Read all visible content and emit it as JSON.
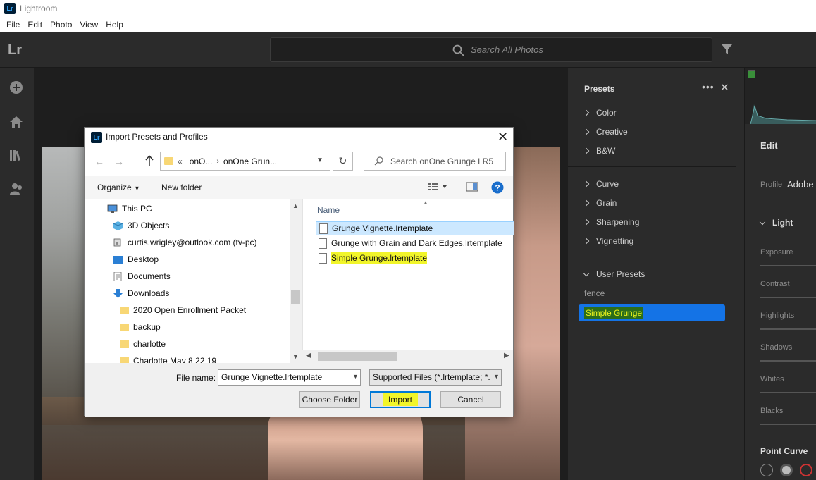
{
  "window": {
    "app_title": "Lightroom",
    "icon_text": "Lr"
  },
  "menubar": [
    "File",
    "Edit",
    "Photo",
    "View",
    "Help"
  ],
  "topbar": {
    "logo": "Lr",
    "search_placeholder": "Search All Photos"
  },
  "presets": {
    "title": "Presets",
    "more": "•••",
    "close": "✕",
    "groups": [
      "Color",
      "Creative",
      "B&W",
      "Curve",
      "Grain",
      "Sharpening",
      "Vignetting"
    ],
    "user_presets_label": "User Presets",
    "user_items": [
      "fence",
      "Simple Grunge"
    ]
  },
  "edit": {
    "title": "Edit",
    "profile_label": "Profile",
    "profile_value": "Adobe S",
    "light_label": "Light",
    "sliders": [
      "Exposure",
      "Contrast",
      "Highlights",
      "Shadows",
      "Whites",
      "Blacks"
    ],
    "point_curve": "Point Curve"
  },
  "dialog": {
    "title": "Import Presets and Profiles",
    "icon_text": "Lr",
    "close": "✕",
    "path_prefix": "«",
    "path_parts": [
      "onO...",
      "onOne Grun..."
    ],
    "search_placeholder": "Search onOne Grunge LR5",
    "organize": "Organize",
    "new_folder": "New folder",
    "tree": [
      "This PC",
      "3D Objects",
      "curtis.wrigley@outlook.com (tv-pc)",
      "Desktop",
      "Documents",
      "Downloads",
      "2020 Open Enrollment Packet",
      "backup",
      "charlotte",
      "Charlotte May 8 22 19"
    ],
    "column_name": "Name",
    "files": [
      "Grunge Vignette.lrtemplate",
      "Grunge with Grain and Dark Edges.lrtemplate",
      "Simple Grunge.lrtemplate"
    ],
    "file_name_label": "File name:",
    "file_name_value": "Grunge Vignette.lrtemplate",
    "file_type": "Supported Files (*.lrtemplate; *.",
    "buttons": {
      "choose_folder": "Choose Folder",
      "import": "Import",
      "cancel": "Cancel"
    }
  },
  "colors": {
    "accent": "#1473e6",
    "highlight": "#f1f52a",
    "panel": "#2b2b2b"
  }
}
